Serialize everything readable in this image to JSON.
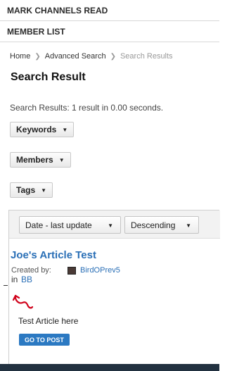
{
  "nav": {
    "mark_channels_read": "MARK CHANNELS READ",
    "member_list": "MEMBER LIST"
  },
  "breadcrumb": {
    "home": "Home",
    "advanced_search": "Advanced Search",
    "current": "Search Results"
  },
  "page_title": "Search Result",
  "summary": "Search Results: 1 result in 0.00 seconds.",
  "filters": {
    "keywords": "Keywords",
    "members": "Members",
    "tags": "Tags"
  },
  "sort": {
    "field": "Date - last update",
    "order": "Descending"
  },
  "result": {
    "title": "Joe's Article Test",
    "created_by_label": "Created by:",
    "author": "BirdOPrev5",
    "in_label": "in",
    "channel": "BB",
    "excerpt": "Test Article here",
    "go_button": "GO TO POST"
  },
  "colors": {
    "link": "#2a6fb6",
    "button": "#2b79c2",
    "annotation": "#d0021b",
    "footer": "#223140"
  },
  "icons": {
    "breadcrumb_separator": "chevron-right-icon",
    "dropdown": "chevron-down-icon",
    "annotation": "hand-drawn-arrow-icon"
  }
}
